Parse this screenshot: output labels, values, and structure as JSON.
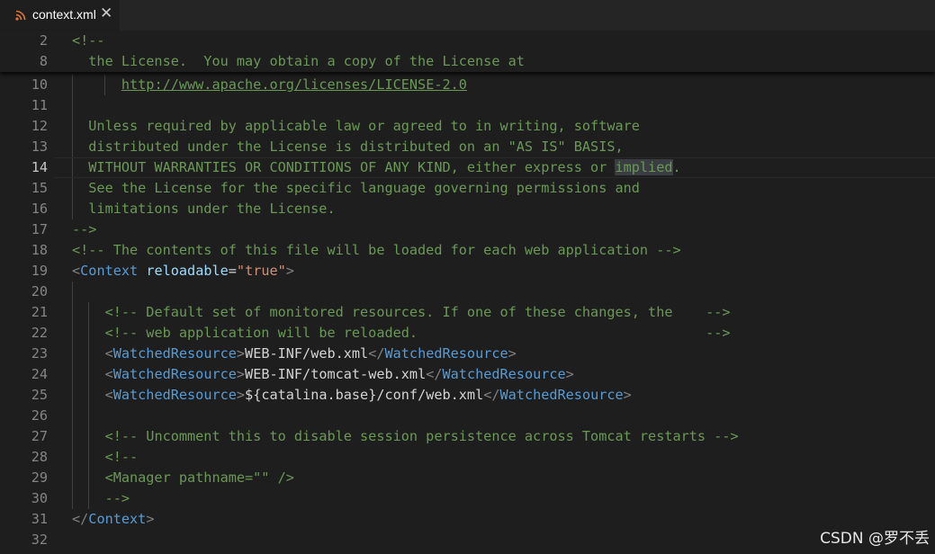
{
  "tab": {
    "title": "context.xml",
    "close": "✕",
    "icon": "rss-icon",
    "icon_color": "#e37933"
  },
  "sticky": [
    {
      "n": "2",
      "code": "<!--"
    },
    {
      "n": "8",
      "code": "  the License.  You may obtain a copy of the License at"
    }
  ],
  "lines": [
    {
      "n": "10",
      "code": "      http://www.apache.org/licenses/LICENSE-2.0"
    },
    {
      "n": "11",
      "code": ""
    },
    {
      "n": "12",
      "code": "  Unless required by applicable law or agreed to in writing, software"
    },
    {
      "n": "13",
      "code": "  distributed under the License is distributed on an \"AS IS\" BASIS,"
    },
    {
      "n": "14",
      "code": "  WITHOUT WARRANTIES OR CONDITIONS OF ANY KIND, either express or implied."
    },
    {
      "n": "15",
      "code": "  See the License for the specific language governing permissions and"
    },
    {
      "n": "16",
      "code": "  limitations under the License."
    },
    {
      "n": "17",
      "code": "-->"
    },
    {
      "n": "18",
      "code": "<!-- The contents of this file will be loaded for each web application -->"
    },
    {
      "n": "19",
      "code": "<Context reloadable=\"true\">"
    },
    {
      "n": "20",
      "code": ""
    },
    {
      "n": "21",
      "code": "    <!-- Default set of monitored resources. If one of these changes, the    -->"
    },
    {
      "n": "22",
      "code": "    <!-- web application will be reloaded.                                   -->"
    },
    {
      "n": "23",
      "code": "    <WatchedResource>WEB-INF/web.xml</WatchedResource>"
    },
    {
      "n": "24",
      "code": "    <WatchedResource>WEB-INF/tomcat-web.xml</WatchedResource>"
    },
    {
      "n": "25",
      "code": "    <WatchedResource>${catalina.base}/conf/web.xml</WatchedResource>"
    },
    {
      "n": "26",
      "code": ""
    },
    {
      "n": "27",
      "code": "    <!-- Uncomment this to disable session persistence across Tomcat restarts -->"
    },
    {
      "n": "28",
      "code": "    <!--"
    },
    {
      "n": "29",
      "code": "    <Manager pathname=\"\" />"
    },
    {
      "n": "30",
      "code": "    -->"
    },
    {
      "n": "31",
      "code": "</Context>"
    },
    {
      "n": "32",
      "code": ""
    }
  ],
  "active_line": "14",
  "highlighted_word": "implied",
  "watermark": "CSDN @罗不丢",
  "colors": {
    "background": "#1e1e1e",
    "comment": "#6a9955",
    "tag": "#569cd6",
    "attribute": "#9cdcfe",
    "string": "#ce9178",
    "punctuation": "#808080",
    "text": "#d4d4d4",
    "line_number": "#858585"
  }
}
